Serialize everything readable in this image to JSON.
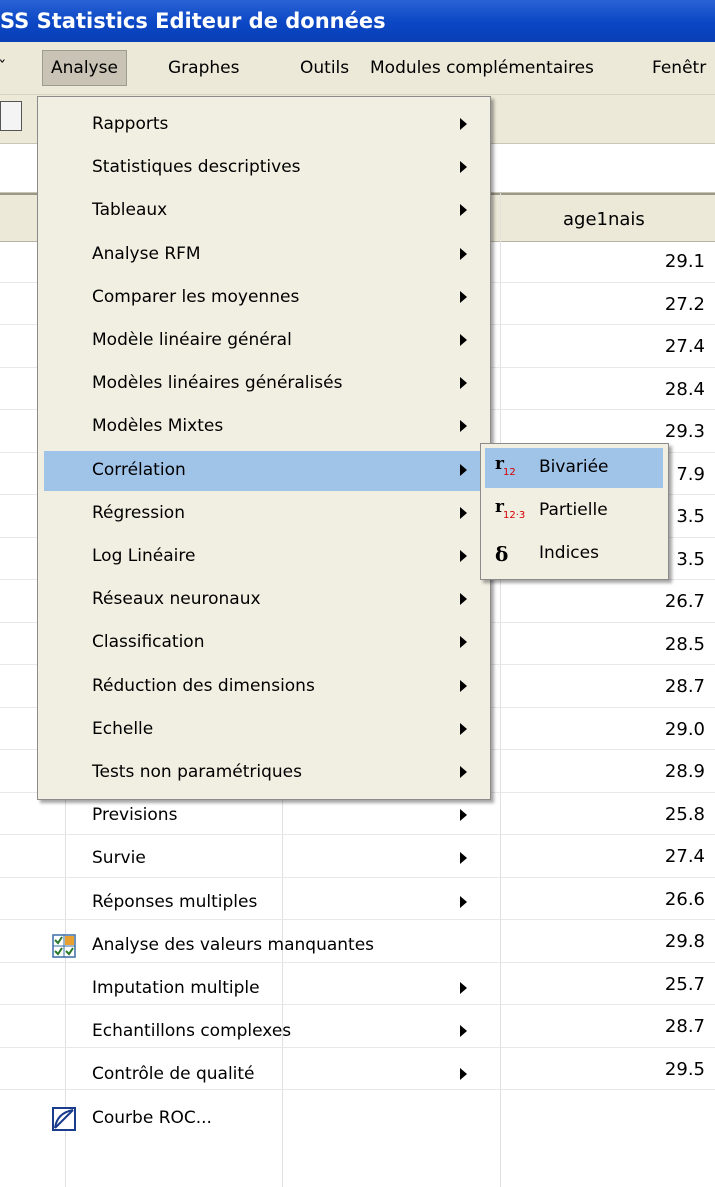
{
  "window": {
    "title": "SS Statistics Editeur de données"
  },
  "menubar": {
    "items": [
      "Analyse",
      "Graphes",
      "Outils",
      "Modules complémentaires",
      "Fenêtr"
    ]
  },
  "grid": {
    "column_header": "age1nais",
    "values": [
      "29.1",
      "27.2",
      "27.4",
      "28.4",
      "29.3",
      "7.9",
      "3.5",
      "3.5",
      "26.7",
      "28.5",
      "28.7",
      "29.0",
      "28.9",
      "25.8",
      "27.4",
      "26.6",
      "29.8",
      "25.7",
      "28.7",
      "29.5"
    ]
  },
  "menu": {
    "items": [
      {
        "label": "Rapports",
        "submenu": true
      },
      {
        "label": "Statistiques descriptives",
        "submenu": true
      },
      {
        "label": "Tableaux",
        "submenu": true
      },
      {
        "label": "Analyse RFM",
        "submenu": true
      },
      {
        "label": "Comparer les moyennes",
        "submenu": true
      },
      {
        "label": "Modèle linéaire général",
        "submenu": true
      },
      {
        "label": "Modèles linéaires généralisés",
        "submenu": true
      },
      {
        "label": "Modèles Mixtes",
        "submenu": true
      },
      {
        "label": "Corrélation",
        "submenu": true,
        "active": true
      },
      {
        "label": "Régression",
        "submenu": true
      },
      {
        "label": "Log Linéaire",
        "submenu": true
      },
      {
        "label": "Réseaux neuronaux",
        "submenu": true
      },
      {
        "label": "Classification",
        "submenu": true
      },
      {
        "label": "Réduction des dimensions",
        "submenu": true
      },
      {
        "label": "Echelle",
        "submenu": true
      },
      {
        "label": "Tests non paramétriques",
        "submenu": true
      },
      {
        "label": "Previsions",
        "submenu": true
      },
      {
        "label": "Survie",
        "submenu": true
      },
      {
        "label": "Réponses multiples",
        "submenu": true
      },
      {
        "label": "Analyse des valeurs manquantes",
        "submenu": false,
        "icon": "missing-values-icon"
      },
      {
        "label": "Imputation multiple",
        "submenu": true
      },
      {
        "label": "Echantillons complexes",
        "submenu": true
      },
      {
        "label": "Contrôle de qualité",
        "submenu": true
      },
      {
        "label": "Courbe ROC...",
        "submenu": false,
        "icon": "roc-curve-icon"
      }
    ]
  },
  "submenu": {
    "items": [
      {
        "label": "Bivariée",
        "icon": "bivariate-r12-icon",
        "icon_text": "r",
        "icon_sub": "12",
        "active": true
      },
      {
        "label": "Partielle",
        "icon": "partial-r12-3-icon",
        "icon_text": "r",
        "icon_sub": "12·3"
      },
      {
        "label": "Indices",
        "icon": "delta-icon",
        "icon_text": "δ"
      }
    ]
  },
  "colors": {
    "title_bar": "#0b46c4",
    "menu_bg": "#f1efe2",
    "highlight": "#a0c3e8",
    "chrome": "#ece9d8"
  }
}
